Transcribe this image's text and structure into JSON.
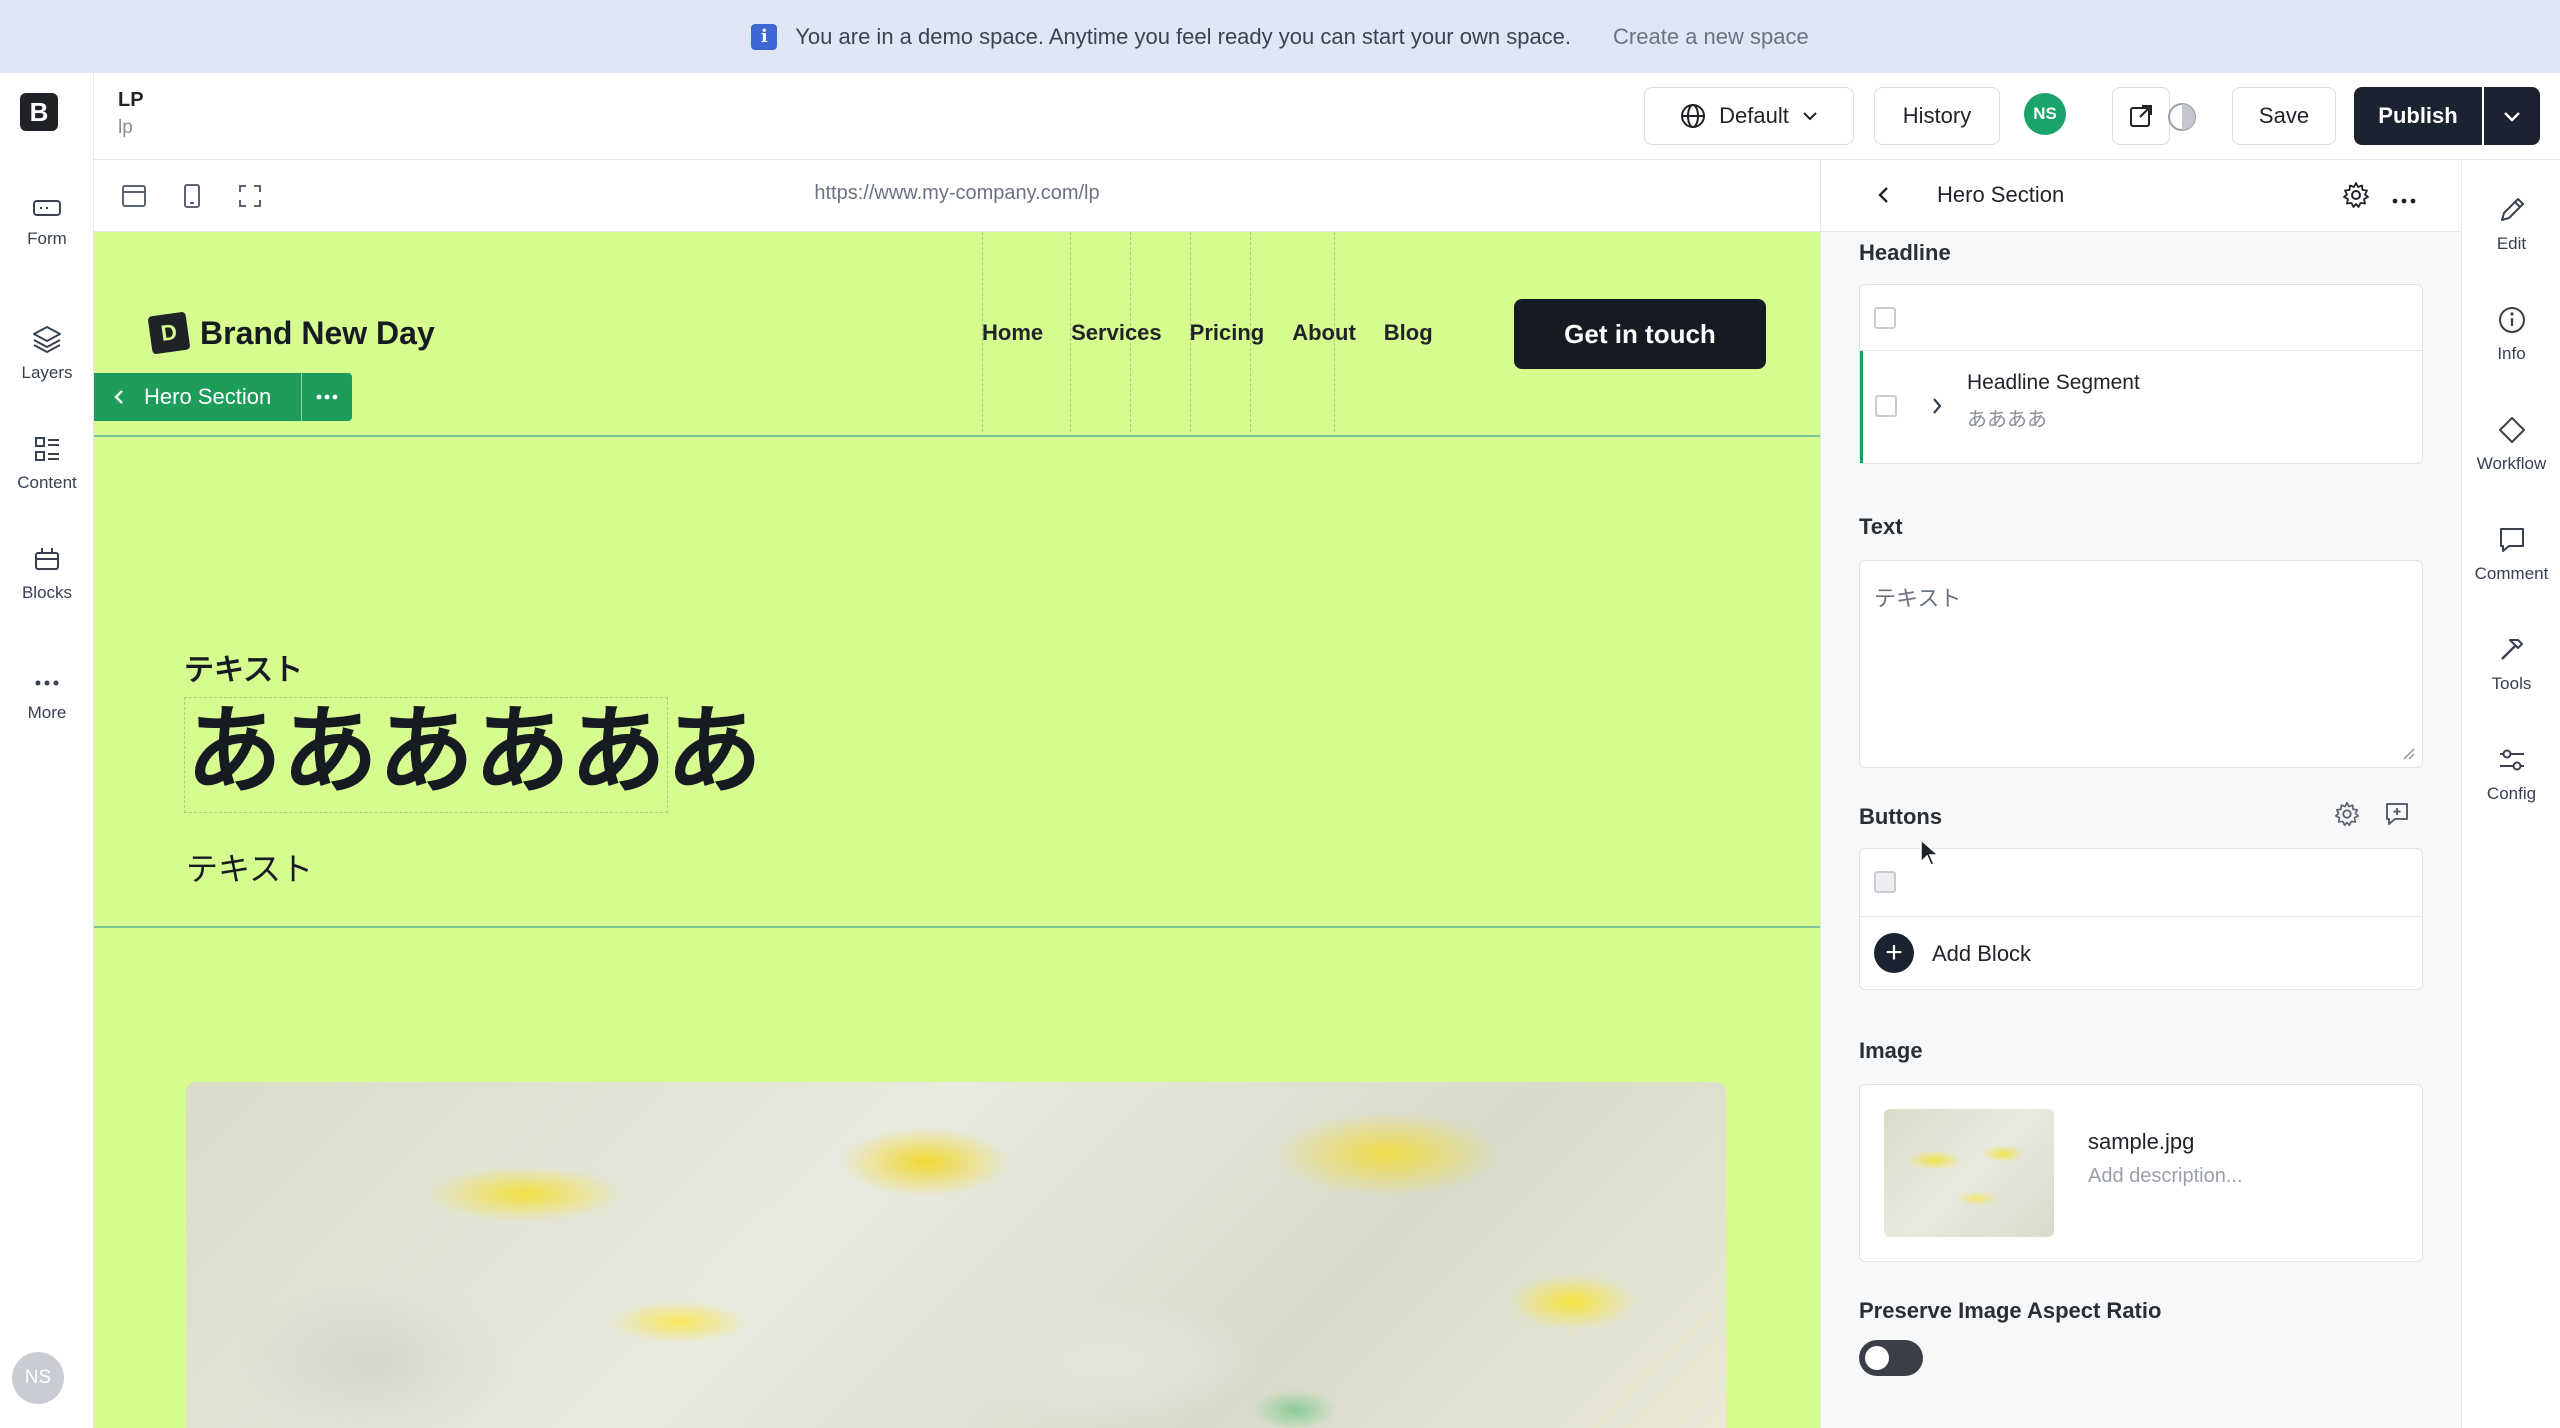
{
  "banner": {
    "icon": "info-icon",
    "icon_glyph": "i",
    "message": "You are in a demo space. Anytime you feel ready you can start your own space.",
    "link": "Create a new space"
  },
  "leftnav": {
    "logo": "B",
    "items": [
      {
        "label": "Form",
        "icon": "form-icon"
      },
      {
        "label": "Layers",
        "icon": "layers-icon"
      },
      {
        "label": "Content",
        "icon": "content-icon"
      },
      {
        "label": "Blocks",
        "icon": "blocks-icon"
      },
      {
        "label": "More",
        "icon": "more-icon"
      }
    ],
    "user_initials": "NS"
  },
  "header": {
    "title": "LP",
    "slug": "lp",
    "locale": "Default",
    "history": "History",
    "user_initials": "NS",
    "save": "Save",
    "publish": "Publish"
  },
  "canvas": {
    "url": "https://www.my-company.com/lp"
  },
  "preview": {
    "brand_mark": "D",
    "brand_name": "Brand New Day",
    "nav": [
      "Home",
      "Services",
      "Pricing",
      "About",
      "Blog"
    ],
    "cta": "Get in touch",
    "section_tag": "Hero Section",
    "eyebrow": "テキスト",
    "headline": "ああああああ",
    "subtext": "テキスト"
  },
  "panel": {
    "title": "Hero Section",
    "headline_label": "Headline",
    "headline_segment_title": "Headline Segment",
    "headline_segment_value": "ああああ",
    "text_label": "Text",
    "text_value": "テキスト",
    "buttons_label": "Buttons",
    "add_block": "Add Block",
    "image_label": "Image",
    "image_file": "sample.jpg",
    "image_description_placeholder": "Add description...",
    "aspect_label": "Preserve Image Aspect Ratio",
    "aspect_enabled": false
  },
  "rail": {
    "items": [
      {
        "label": "Edit",
        "icon": "pencil-icon"
      },
      {
        "label": "Info",
        "icon": "info-circle-icon"
      },
      {
        "label": "Workflow",
        "icon": "workflow-diamond-icon"
      },
      {
        "label": "Comment",
        "icon": "comment-icon"
      },
      {
        "label": "Tools",
        "icon": "hammer-icon"
      },
      {
        "label": "Config",
        "icon": "sliders-icon"
      }
    ]
  },
  "colors": {
    "banner_bg": "#dfe7f6",
    "preview_bg": "#d6fb8e",
    "accent_green": "#1d9c5a",
    "primary_dark": "#1b2230"
  }
}
